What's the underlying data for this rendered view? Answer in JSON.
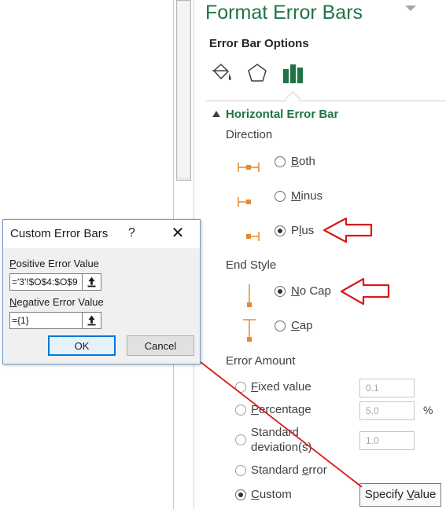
{
  "pane": {
    "title": "Format Error Bars",
    "options_label": "Error Bar Options",
    "tabs": [
      {
        "icon": "paint-bucket-icon"
      },
      {
        "icon": "pentagon-icon"
      },
      {
        "icon": "bar-chart-icon"
      }
    ],
    "section_title": "Horizontal Error Bar",
    "direction": {
      "label": "Direction",
      "options": [
        {
          "label": "Both",
          "selected": false
        },
        {
          "label": "Minus",
          "selected": false
        },
        {
          "label": "Plus",
          "selected": true
        }
      ]
    },
    "end_style": {
      "label": "End Style",
      "options": [
        {
          "label": "No Cap",
          "selected": true
        },
        {
          "label": "Cap",
          "selected": false
        }
      ]
    },
    "error_amount": {
      "label": "Error Amount",
      "fixed_value": {
        "label": "Fixed value",
        "value": "0.1"
      },
      "percentage": {
        "label": "Percentage",
        "value": "5.0",
        "unit": "%"
      },
      "std_dev": {
        "label": "Standard deviation(s)",
        "line1": "Standard",
        "line2": "deviation(s)",
        "value": "1.0"
      },
      "std_error": {
        "label": "Standard error"
      },
      "custom": {
        "label": "Custom",
        "selected": true
      },
      "specify_button": "Specify Value"
    }
  },
  "dialog": {
    "title": "Custom Error Bars",
    "help": "?",
    "close": "✕",
    "positive_label": "Positive Error Value",
    "positive_value": "='3'!$O$4:$O$9",
    "negative_label": "Negative Error Value",
    "negative_value": "={1}",
    "ok": "OK",
    "cancel": "Cancel"
  },
  "colors": {
    "accent_green": "#217346",
    "annotation_red": "#d9191c",
    "error_bar_orange": "#e8892b"
  }
}
